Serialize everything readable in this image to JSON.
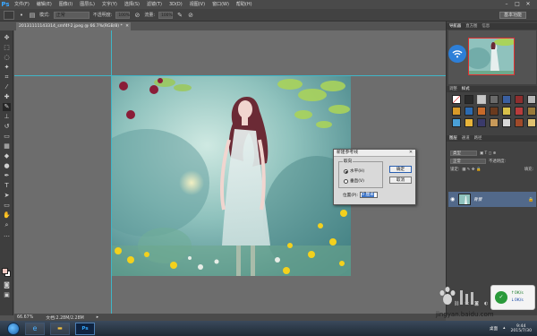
{
  "app": {
    "name": "Ps",
    "menu": [
      "文件(F)",
      "编辑(E)",
      "图像(I)",
      "图层(L)",
      "文字(Y)",
      "选择(S)",
      "滤镜(T)",
      "3D(D)",
      "视图(V)",
      "窗口(W)",
      "帮助(H)"
    ]
  },
  "options_bar": {
    "mode_label": "模式:",
    "mode_value": "正常",
    "opacity_label": "不透明度:",
    "opacity_value": "100%",
    "flow_label": "流量:",
    "flow_value": "100%",
    "workspace": "基本功能"
  },
  "document": {
    "tab_title": "20131111143314_smf4f-2.jpeg @ 66.7%(RGB/8) *",
    "zoom": "66.67%",
    "doc_info": "文档:2.28M/2.28M"
  },
  "panels": {
    "nav_tabs": [
      "导航器",
      "直方图",
      "信息"
    ],
    "style_tabs": [
      "调整",
      "样式"
    ],
    "layer_tabs": [
      "图层",
      "通道",
      "路径"
    ],
    "layer_kind": "类型",
    "blend_mode": "正常",
    "opacity_label": "不透明度:",
    "fill_label": "填充:",
    "lock_label": "锁定:",
    "layer_name": "背景"
  },
  "dialog": {
    "title": "新建参考线",
    "group_label": "取向",
    "horizontal": "水平(H)",
    "vertical": "垂直(V)",
    "position_label": "位置(P):",
    "position_value": "0 厘米",
    "ok": "确定",
    "cancel": "取消"
  },
  "taskbar": {
    "desktop": "桌面",
    "time": "9:44",
    "date": "2015/7/30"
  },
  "watermark": {
    "site": "jingyan.baidu.com",
    "net_up": "0K/s",
    "net_down": "0K/s"
  },
  "colors": {
    "accent": "#3aa6ff",
    "guide": "#3fb6c7",
    "layer_selected": "#52698a"
  }
}
